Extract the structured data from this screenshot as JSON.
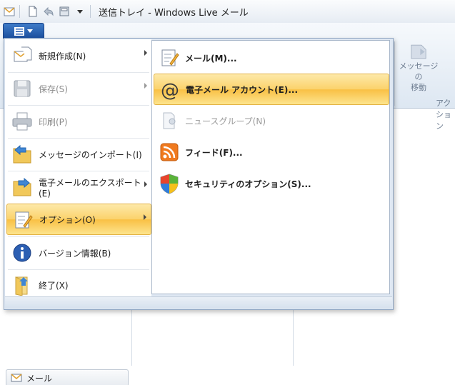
{
  "window": {
    "title": "送信トレイ - Windows Live メール"
  },
  "ribbon": {
    "move_message_line1": "メッセージの",
    "move_message_line2": "移動",
    "group_label": "アクション"
  },
  "nav": {
    "mail_label": "メール"
  },
  "app_menu": {
    "items": [
      {
        "label": "新規作成(N)",
        "icon": "new-document-icon",
        "submenu": true,
        "enabled": true
      },
      {
        "label": "保存(S)",
        "icon": "floppy-disk-icon",
        "submenu": true,
        "enabled": false
      },
      {
        "label": "印刷(P)",
        "icon": "printer-icon",
        "submenu": false,
        "enabled": false
      },
      {
        "label": "メッセージのインポート(I)",
        "icon": "import-folder-icon",
        "submenu": false,
        "enabled": true
      },
      {
        "label": "電子メールのエクスポート(E)",
        "icon": "export-folder-icon",
        "submenu": true,
        "enabled": true
      },
      {
        "label": "オプション(O)",
        "icon": "options-checklist-icon",
        "submenu": true,
        "enabled": true,
        "selected": true
      },
      {
        "label": "バージョン情報(B)",
        "icon": "info-icon",
        "submenu": false,
        "enabled": true
      },
      {
        "label": "終了(X)",
        "icon": "exit-icon",
        "submenu": false,
        "enabled": true
      }
    ]
  },
  "options_submenu": {
    "items": [
      {
        "label": "メール(M)...",
        "icon": "mail-checklist-icon",
        "enabled": true
      },
      {
        "label": "電子メール アカウント(E)...",
        "icon": "at-sign-icon",
        "enabled": true,
        "selected": true
      },
      {
        "label": "ニュースグループ(N)",
        "icon": "newsgroup-icon",
        "enabled": false
      },
      {
        "label": "フィード(F)...",
        "icon": "rss-feed-icon",
        "enabled": true
      },
      {
        "label": "セキュリティのオプション(S)...",
        "icon": "security-shield-icon",
        "enabled": true
      }
    ]
  },
  "colors": {
    "highlight": "#fbd26b",
    "app_button": "#2a62b4",
    "at_sign": "#3b3b3b",
    "rss": "#f07a1f"
  }
}
